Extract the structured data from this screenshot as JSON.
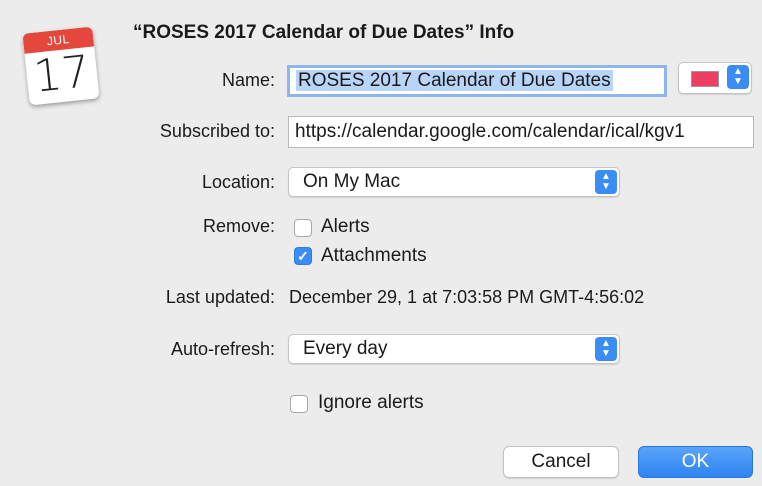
{
  "icon": {
    "month": "JUL",
    "day": "17"
  },
  "dialog": {
    "title": "“ROSES 2017 Calendar of Due Dates” Info"
  },
  "name": {
    "label": "Name:",
    "value": "ROSES 2017 Calendar of Due Dates",
    "color": "#ef3e64"
  },
  "subscribed": {
    "label": "Subscribed to:",
    "value": "https://calendar.google.com/calendar/ical/kgv1"
  },
  "location": {
    "label": "Location:",
    "value": "On My Mac"
  },
  "remove": {
    "label": "Remove:",
    "alerts": {
      "label": "Alerts",
      "checked": false
    },
    "attachments": {
      "label": "Attachments",
      "checked": true
    }
  },
  "last_updated": {
    "label": "Last updated:",
    "value": "December 29, 1 at 7:03:58 PM GMT-4:56:02"
  },
  "auto_refresh": {
    "label": "Auto-refresh:",
    "value": "Every day"
  },
  "ignore_alerts": {
    "label": "Ignore alerts",
    "checked": false
  },
  "buttons": {
    "cancel": "Cancel",
    "ok": "OK"
  },
  "accent_color": "#3b8df3"
}
